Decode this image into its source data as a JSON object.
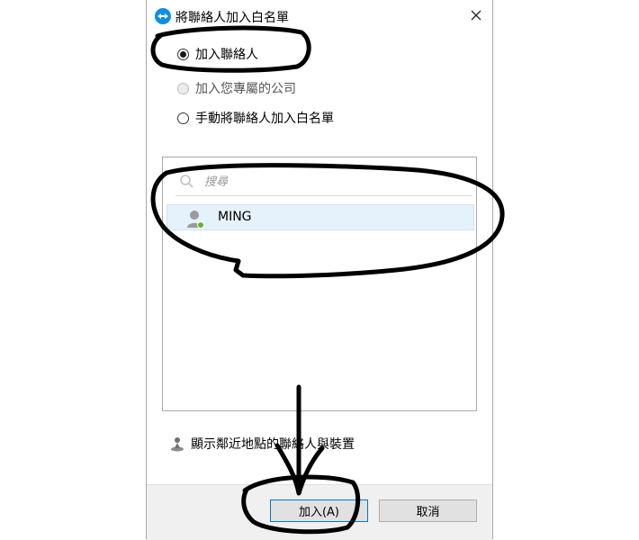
{
  "window": {
    "title": "將聯絡人加入白名單",
    "close_icon": "close-icon",
    "app_icon": "teamviewer-logo-icon"
  },
  "options": [
    {
      "label": "加入聯絡人",
      "checked": true,
      "enabled": true
    },
    {
      "label": "加入您專屬的公司",
      "checked": false,
      "enabled": false
    },
    {
      "label": "手動將聯絡人加入白名單",
      "checked": false,
      "enabled": true
    }
  ],
  "search": {
    "placeholder": "搜尋"
  },
  "contacts": [
    {
      "name": "MING",
      "status": "online",
      "status_color": "#5cb82c"
    }
  ],
  "nearby": {
    "label": "顯示鄰近地點的聯絡人與裝置"
  },
  "buttons": {
    "add": "加入(A)",
    "cancel": "取消"
  }
}
